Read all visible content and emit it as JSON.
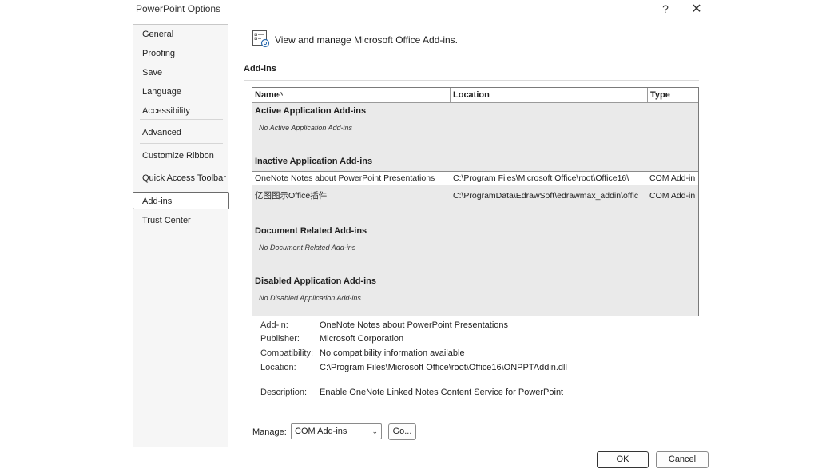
{
  "window": {
    "title": "PowerPoint Options",
    "help": "?",
    "close": "✕"
  },
  "sidebar": {
    "items": [
      {
        "label": "General"
      },
      {
        "label": "Proofing"
      },
      {
        "label": "Save"
      },
      {
        "label": "Language"
      },
      {
        "label": "Accessibility"
      },
      {
        "label": "Advanced"
      },
      {
        "label": "Customize Ribbon"
      },
      {
        "label": "Quick Access Toolbar"
      },
      {
        "label": "Add-ins"
      },
      {
        "label": "Trust Center"
      }
    ],
    "selected": "Add-ins"
  },
  "header": {
    "text": "View and manage Microsoft Office Add-ins.",
    "icon": "addins-gear-icon"
  },
  "section": {
    "title": "Add-ins"
  },
  "grid": {
    "columns": [
      "Name",
      "Location",
      "Type"
    ],
    "sort_indicator": "^",
    "groups": {
      "active": {
        "title": "Active Application Add-ins",
        "empty": "No Active Application Add-ins"
      },
      "inactive": {
        "title": "Inactive Application Add-ins",
        "rows": [
          {
            "name": "OneNote Notes about PowerPoint Presentations",
            "location": "C:\\Program Files\\Microsoft Office\\root\\Office16\\",
            "type": "COM Add-in"
          },
          {
            "name": "亿图图示Office插件",
            "location": "C:\\ProgramData\\EdrawSoft\\edrawmax_addin\\offic",
            "type": "COM Add-in"
          }
        ]
      },
      "document": {
        "title": "Document Related Add-ins",
        "empty": "No Document Related Add-ins"
      },
      "disabled": {
        "title": "Disabled Application Add-ins",
        "empty": "No Disabled Application Add-ins"
      }
    }
  },
  "details": {
    "addin_label": "Add-in:",
    "addin": "OneNote Notes about PowerPoint Presentations",
    "publisher_label": "Publisher:",
    "publisher": "Microsoft Corporation",
    "compat_label": "Compatibility:",
    "compat": "No compatibility information available",
    "location_label": "Location:",
    "location": "C:\\Program Files\\Microsoft Office\\root\\Office16\\ONPPTAddin.dll",
    "desc_label": "Description:",
    "desc": "Enable OneNote Linked Notes Content Service for PowerPoint"
  },
  "manage": {
    "label": "Manage:",
    "selected": "COM Add-ins",
    "go": "Go..."
  },
  "footer": {
    "ok": "OK",
    "cancel": "Cancel"
  }
}
